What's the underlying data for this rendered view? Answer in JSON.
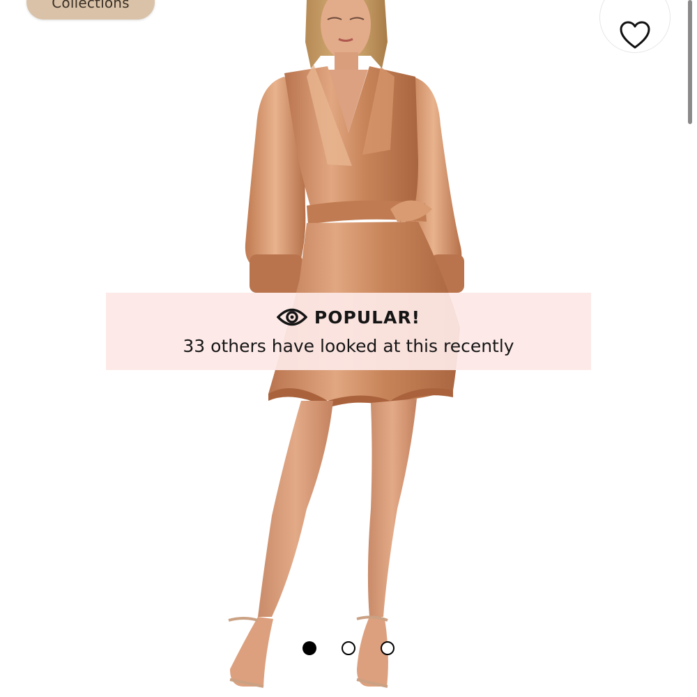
{
  "header": {
    "collections_label": "Collections",
    "wishlist_icon": "heart-outline-icon"
  },
  "banner": {
    "icon": "eye-icon",
    "title": "POPULAR!",
    "subtitle": "33 others have looked at this recently"
  },
  "carousel": {
    "current_slide": 1,
    "total_slides": 3
  },
  "colors": {
    "banner_background": "#fde8e6",
    "chip_background": "#d9c2a8",
    "dress": "#c98a62"
  }
}
